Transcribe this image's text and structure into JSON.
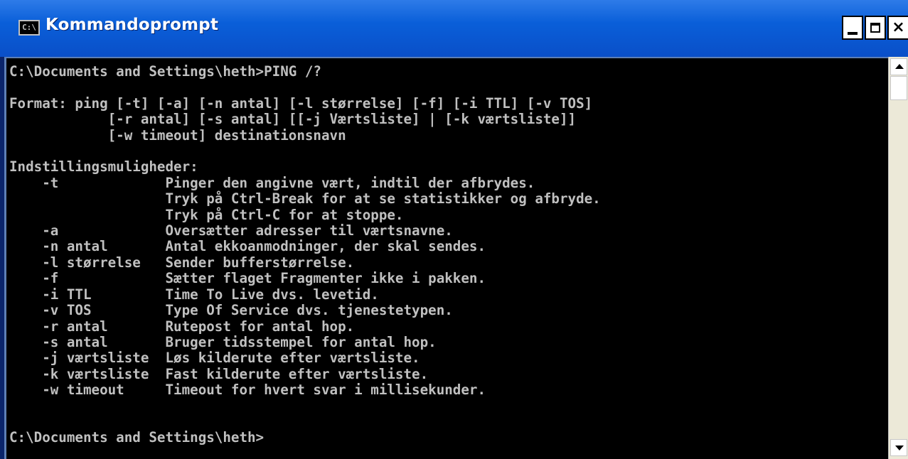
{
  "window": {
    "title": "Kommandoprompt",
    "icon": "console-icon",
    "icon_text": "C:\\",
    "controls": {
      "minimize": "minimize-icon",
      "maximize": "maximize-icon",
      "close": "close-icon",
      "close_glyph": "×"
    }
  },
  "colors": {
    "titlebar": "#0a5fd9",
    "console_bg": "#000000",
    "console_fg": "#c0c0c0",
    "scrollbar": "#ece9d8"
  },
  "console": {
    "lines": [
      "C:\\Documents and Settings\\heth>PING /?",
      "",
      "Format: ping [-t] [-a] [-n antal] [-l størrelse] [-f] [-i TTL] [-v TOS]",
      "            [-r antal] [-s antal] [[-j Værtsliste] | [-k værtsliste]]",
      "            [-w timeout] destinationsnavn",
      "",
      "Indstillingsmuligheder:",
      "    -t             Pinger den angivne vært, indtil der afbrydes.",
      "                   Tryk på Ctrl-Break for at se statistikker og afbryde.",
      "                   Tryk på Ctrl-C for at stoppe.",
      "    -a             Oversætter adresser til værtsnavne.",
      "    -n antal       Antal ekkoanmodninger, der skal sendes.",
      "    -l størrelse   Sender bufferstørrelse.",
      "    -f             Sætter flaget Fragmenter ikke i pakken.",
      "    -i TTL         Time To Live dvs. levetid.",
      "    -v TOS         Type Of Service dvs. tjenestetypen.",
      "    -r antal       Rutepost for antal hop.",
      "    -s antal       Bruger tidsstempel for antal hop.",
      "    -j værtsliste  Løs kilderute efter værtsliste.",
      "    -k værtsliste  Fast kilderute efter værtsliste.",
      "    -w timeout     Timeout for hvert svar i millisekunder.",
      "",
      "",
      "C:\\Documents and Settings\\heth>"
    ]
  },
  "scrollbar": {
    "up_icon": "scroll-up-arrow-icon",
    "down_icon": "scroll-down-arrow-icon"
  }
}
